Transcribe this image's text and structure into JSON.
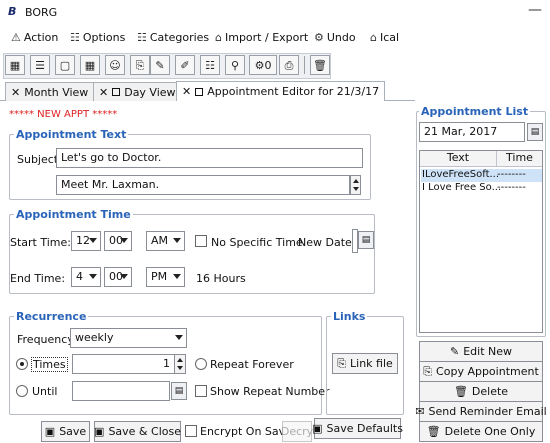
{
  "window": {
    "logo": "B",
    "title": "BORG",
    "minimize": "—"
  },
  "menu": [
    {
      "label": "Action",
      "icon": "⚠"
    },
    {
      "label": "Options",
      "icon": "☷"
    },
    {
      "label": "Categories",
      "icon": "☷"
    },
    {
      "label": "Import / Export",
      "icon": "⌂"
    },
    {
      "label": "Undo",
      "icon": "⚙"
    },
    {
      "label": "Ical",
      "icon": "⌂"
    }
  ],
  "toolbar": {
    "zero_count": "0"
  },
  "tabs": [
    {
      "label": "Month View"
    },
    {
      "label": "Day View"
    },
    {
      "label": "Appointment Editor for 21/3/17"
    }
  ],
  "editor": {
    "banner": "***** NEW APPT *****",
    "text_group": {
      "legend": "Appointment Text",
      "subject_label": "Subject",
      "subject_value": "Let's go to Doctor.",
      "body_value": "Meet Mr. Laxman."
    },
    "time_group": {
      "legend": "Appointment Time",
      "start_label": "Start Time:",
      "start_hour": "12",
      "start_min": "00",
      "start_ampm": "AM",
      "no_specific_time": "No Specific Time",
      "new_date_label": "New Date:",
      "end_label": "End Time:",
      "end_hour": "4",
      "end_min": "00",
      "end_ampm": "PM",
      "duration": "16 Hours"
    },
    "recurrence": {
      "legend": "Recurrence",
      "frequency_label": "Frequency",
      "frequency_value": "weekly",
      "times_label": "Times",
      "times_value": "1",
      "repeat_forever": "Repeat Forever",
      "until_label": "Until",
      "show_repeat_number": "Show Repeat Number"
    },
    "links": {
      "legend": "Links",
      "link_file": "Link file"
    }
  },
  "appointment_list": {
    "title": "Appointment List",
    "date_value": "21 Mar, 2017",
    "columns": [
      "Text",
      "Time"
    ],
    "rows": [
      {
        "text": "ILoveFreeSoft...",
        "time": "--------"
      },
      {
        "text": "I Love Free So...",
        "time": "--------"
      }
    ]
  },
  "actions": {
    "edit_new": "Edit New",
    "copy": "Copy Appointment",
    "delete": "Delete",
    "send_reminder": "Send Reminder Email",
    "delete_one": "Delete One Only"
  },
  "footer": {
    "save": "Save",
    "save_close": "Save & Close",
    "encrypt": "Encrypt On Save",
    "decrypt": "Decry",
    "save_defaults": "Save Defaults"
  }
}
